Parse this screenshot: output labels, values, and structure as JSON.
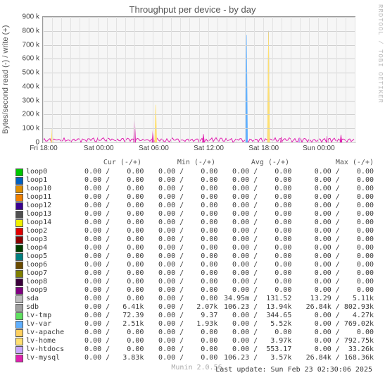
{
  "title": "Throughput per device - by day",
  "watermark": "RRDTOOL / TOBI OETIKER",
  "ylabel": "Bytes/second read (-) / write (+)",
  "footer_tool": "Munin 2.0.56",
  "last_update": "Last update: Sun Feb 23 02:30:06 2025",
  "yticks": [
    "0",
    "100 k",
    "200 k",
    "300 k",
    "400 k",
    "500 k",
    "600 k",
    "700 k",
    "800 k",
    "900 k"
  ],
  "xticks": [
    "Fri 18:00",
    "Sat 00:00",
    "Sat 06:00",
    "Sat 12:00",
    "Sat 18:00",
    "Sun 00:00"
  ],
  "legend_header": {
    "name": "",
    "cur": "Cur (-/+)",
    "min": "Min (-/+)",
    "avg": "Avg (-/+)",
    "max": "Max (-/+)"
  },
  "series": [
    {
      "name": "loop0",
      "color": "#00c800",
      "cur_r": "0.00",
      "cur_w": "0.00",
      "min_r": "0.00",
      "min_w": "0.00",
      "avg_r": "0.00",
      "avg_w": "0.00",
      "max_r": "0.00",
      "max_w": "0.00"
    },
    {
      "name": "loop1",
      "color": "#0060c0",
      "cur_r": "0.00",
      "cur_w": "0.00",
      "min_r": "0.00",
      "min_w": "0.00",
      "avg_r": "0.00",
      "avg_w": "0.00",
      "max_r": "0.00",
      "max_w": "0.00"
    },
    {
      "name": "loop10",
      "color": "#e09000",
      "cur_r": "0.00",
      "cur_w": "0.00",
      "min_r": "0.00",
      "min_w": "0.00",
      "avg_r": "0.00",
      "avg_w": "0.00",
      "max_r": "0.00",
      "max_w": "0.00"
    },
    {
      "name": "loop11",
      "color": "#f08000",
      "cur_r": "0.00",
      "cur_w": "0.00",
      "min_r": "0.00",
      "min_w": "0.00",
      "avg_r": "0.00",
      "avg_w": "0.00",
      "max_r": "0.00",
      "max_w": "0.00"
    },
    {
      "name": "loop12",
      "color": "#3a0090",
      "cur_r": "0.00",
      "cur_w": "0.00",
      "min_r": "0.00",
      "min_w": "0.00",
      "avg_r": "0.00",
      "avg_w": "0.00",
      "max_r": "0.00",
      "max_w": "0.00"
    },
    {
      "name": "loop13",
      "color": "#505050",
      "cur_r": "0.00",
      "cur_w": "0.00",
      "min_r": "0.00",
      "min_w": "0.00",
      "avg_r": "0.00",
      "avg_w": "0.00",
      "max_r": "0.00",
      "max_w": "0.00"
    },
    {
      "name": "loop14",
      "color": "#f0f000",
      "cur_r": "0.00",
      "cur_w": "0.00",
      "min_r": "0.00",
      "min_w": "0.00",
      "avg_r": "0.00",
      "avg_w": "0.00",
      "max_r": "0.00",
      "max_w": "0.00"
    },
    {
      "name": "loop2",
      "color": "#e00000",
      "cur_r": "0.00",
      "cur_w": "0.00",
      "min_r": "0.00",
      "min_w": "0.00",
      "avg_r": "0.00",
      "avg_w": "0.00",
      "max_r": "0.00",
      "max_w": "0.00"
    },
    {
      "name": "loop3",
      "color": "#8b0000",
      "cur_r": "0.00",
      "cur_w": "0.00",
      "min_r": "0.00",
      "min_w": "0.00",
      "avg_r": "0.00",
      "avg_w": "0.00",
      "max_r": "0.00",
      "max_w": "0.00"
    },
    {
      "name": "loop4",
      "color": "#004000",
      "cur_r": "0.00",
      "cur_w": "0.00",
      "min_r": "0.00",
      "min_w": "0.00",
      "avg_r": "0.00",
      "avg_w": "0.00",
      "max_r": "0.00",
      "max_w": "0.00"
    },
    {
      "name": "loop5",
      "color": "#008080",
      "cur_r": "0.00",
      "cur_w": "0.00",
      "min_r": "0.00",
      "min_w": "0.00",
      "avg_r": "0.00",
      "avg_w": "0.00",
      "max_r": "0.00",
      "max_w": "0.00"
    },
    {
      "name": "loop6",
      "color": "#6a4a00",
      "cur_r": "0.00",
      "cur_w": "0.00",
      "min_r": "0.00",
      "min_w": "0.00",
      "avg_r": "0.00",
      "avg_w": "0.00",
      "max_r": "0.00",
      "max_w": "0.00"
    },
    {
      "name": "loop7",
      "color": "#808000",
      "cur_r": "0.00",
      "cur_w": "0.00",
      "min_r": "0.00",
      "min_w": "0.00",
      "avg_r": "0.00",
      "avg_w": "0.00",
      "max_r": "0.00",
      "max_w": "0.00"
    },
    {
      "name": "loop8",
      "color": "#3a003a",
      "cur_r": "0.00",
      "cur_w": "0.00",
      "min_r": "0.00",
      "min_w": "0.00",
      "avg_r": "0.00",
      "avg_w": "0.00",
      "max_r": "0.00",
      "max_w": "0.00"
    },
    {
      "name": "loop9",
      "color": "#800080",
      "cur_r": "0.00",
      "cur_w": "0.00",
      "min_r": "0.00",
      "min_w": "0.00",
      "avg_r": "0.00",
      "avg_w": "0.00",
      "max_r": "0.00",
      "max_w": "0.00"
    },
    {
      "name": "sda",
      "color": "#bdbdbd",
      "cur_r": "0.00",
      "cur_w": "0.00",
      "min_r": "0.00",
      "min_w": "0.00",
      "avg_r": "34.95m",
      "avg_w": "131.52",
      "max_r": "13.29",
      "max_w": "5.11k"
    },
    {
      "name": "sdb",
      "color": "#a0a0a0",
      "cur_r": "0.00",
      "cur_w": "6.41k",
      "min_r": "0.00",
      "min_w": "2.07k",
      "avg_r": "106.23",
      "avg_w": "13.94k",
      "max_r": "26.84k",
      "max_w": "802.93k"
    },
    {
      "name": "lv-tmp",
      "color": "#60e060",
      "cur_r": "0.00",
      "cur_w": "72.39",
      "min_r": "0.00",
      "min_w": "9.37",
      "avg_r": "0.00",
      "avg_w": "344.65",
      "max_r": "0.00",
      "max_w": "4.27k"
    },
    {
      "name": "lv-var",
      "color": "#60b0ff",
      "cur_r": "0.00",
      "cur_w": "2.51k",
      "min_r": "0.00",
      "min_w": "1.93k",
      "avg_r": "0.00",
      "avg_w": "5.52k",
      "max_r": "0.00",
      "max_w": "769.02k"
    },
    {
      "name": "lv-apache",
      "color": "#ffd060",
      "cur_r": "0.00",
      "cur_w": "0.00",
      "min_r": "0.00",
      "min_w": "0.00",
      "avg_r": "0.00",
      "avg_w": "0.00",
      "max_r": "0.00",
      "max_w": "0.00"
    },
    {
      "name": "lv-home",
      "color": "#ffe070",
      "cur_r": "0.00",
      "cur_w": "0.00",
      "min_r": "0.00",
      "min_w": "0.00",
      "avg_r": "0.00",
      "avg_w": "3.97k",
      "max_r": "0.00",
      "max_w": "792.75k"
    },
    {
      "name": "lv-htdocs",
      "color": "#c8a8ff",
      "cur_r": "0.00",
      "cur_w": "0.00",
      "min_r": "0.00",
      "min_w": "0.00",
      "avg_r": "0.00",
      "avg_w": "553.17",
      "max_r": "0.00",
      "max_w": "33.26k"
    },
    {
      "name": "lv-mysql",
      "color": "#e020b0",
      "cur_r": "0.00",
      "cur_w": "3.83k",
      "min_r": "0.00",
      "min_w": "0.00",
      "avg_r": "106.23",
      "avg_w": "3.57k",
      "max_r": "26.84k",
      "max_w": "168.36k"
    }
  ],
  "chart_data": {
    "type": "line",
    "title": "Throughput per device - by day",
    "ylabel": "Bytes/second read (-) / write (+)",
    "xlabel": "",
    "ylim": [
      0,
      900000
    ],
    "x_range_hours": [
      18,
      52
    ],
    "x_tick_labels": [
      "Fri 18:00",
      "Sat 00:00",
      "Sat 06:00",
      "Sat 12:00",
      "Sat 18:00",
      "Sun 00:00"
    ],
    "note": "Most loop* series and lv-apache are flat at 0 the entire window.",
    "peaks": [
      {
        "series": "lv-home",
        "x_hour": 19.0,
        "value": 100000,
        "color": "#ffe070"
      },
      {
        "series": "lv-mysql",
        "x_hour": 28.0,
        "value": 160000,
        "color": "#e020b0"
      },
      {
        "series": "lv-home",
        "x_hour": 30.3,
        "value": 270000,
        "color": "#ffe070"
      },
      {
        "series": "lv-mysql",
        "x_hour": 30.0,
        "value": 90000,
        "color": "#e020b0"
      },
      {
        "series": "lv-mysql",
        "x_hour": 35.5,
        "value": 60000,
        "color": "#e020b0"
      },
      {
        "series": "lv-var",
        "x_hour": 40.2,
        "value": 770000,
        "color": "#60b0ff"
      },
      {
        "series": "sdb",
        "x_hour": 42.6,
        "value": 800000,
        "color": "#a0a0a0"
      },
      {
        "series": "lv-home",
        "x_hour": 42.6,
        "value": 790000,
        "color": "#ffe070"
      },
      {
        "series": "lv-mysql",
        "x_hour": 44.0,
        "value": 40000,
        "color": "#e020b0"
      },
      {
        "series": "lv-htdocs",
        "x_hour": 46.0,
        "value": 30000,
        "color": "#c8a8ff"
      },
      {
        "series": "lv-mysql",
        "x_hour": 49.0,
        "value": 45000,
        "color": "#e020b0"
      },
      {
        "series": "lv-mysql",
        "x_hour": 50.5,
        "value": 55000,
        "color": "#e020b0"
      }
    ]
  }
}
